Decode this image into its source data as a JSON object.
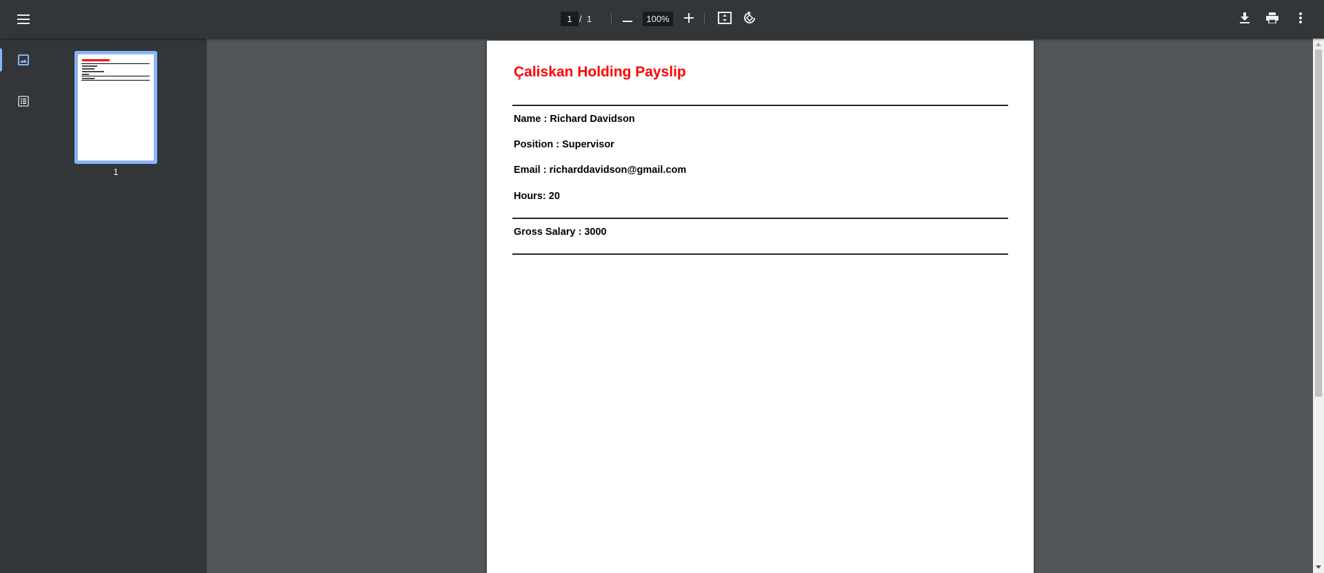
{
  "toolbar": {
    "menu_icon": "hamburger-menu-icon",
    "current_page": "1",
    "page_separator": "/",
    "total_pages": "1",
    "zoom": "100%",
    "zoom_out_icon": "minus-icon",
    "zoom_in_icon": "plus-icon",
    "fit_icon": "fit-to-page-icon",
    "rotate_icon": "rotate-icon",
    "download_icon": "download-icon",
    "print_icon": "print-icon",
    "more_icon": "more-vert-icon"
  },
  "sidebar": {
    "thumbnails_icon": "image-thumbnail-icon",
    "outline_icon": "document-outline-icon",
    "thumbnail_page_number": "1"
  },
  "document": {
    "title": "Çaliskan Holding Payslip",
    "name_line": "Name : Richard Davidson",
    "position_line": "Position : Supervisor",
    "email_line": "Email : richarddavidson@gmail.com",
    "hours_line": "Hours: 20",
    "gross_salary_line": "Gross Salary : 3000"
  },
  "colors": {
    "toolbar_bg": "#323639",
    "viewer_bg": "#525659",
    "title_red": "#ff0000",
    "active_accent": "#8ab4f8"
  }
}
